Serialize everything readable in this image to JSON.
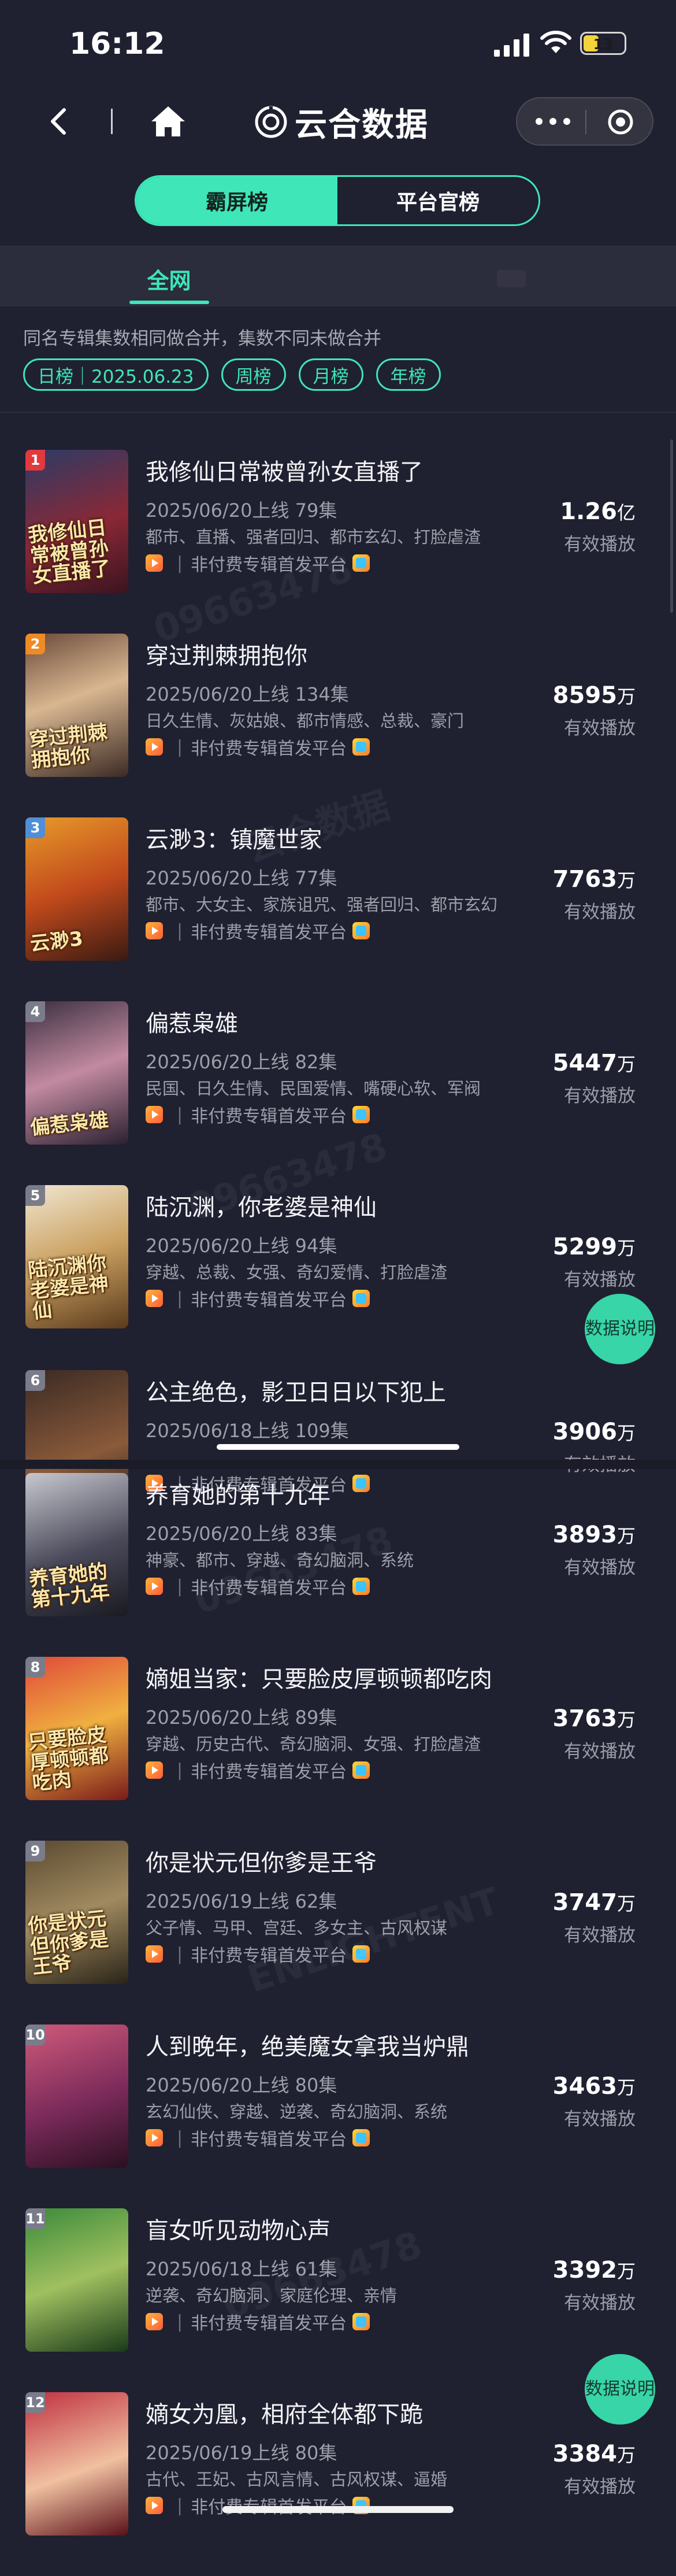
{
  "status_bar": {
    "time": "16:12",
    "battery": "13"
  },
  "nav": {
    "title": "云合数据"
  },
  "segment": {
    "tab_active": "霸屏榜",
    "tab_inactive": "平台官榜"
  },
  "subtab": {
    "label": "全网"
  },
  "note": "同名专辑集数相同做合并，集数不同未做合并",
  "chips": [
    "日榜｜2025.06.23",
    "周榜",
    "月榜",
    "年榜"
  ],
  "common": {
    "platform_label": "非付费专辑首发平台",
    "value_label": "有效播放",
    "float_button": "数据说明",
    "platform_separator": "|"
  },
  "watermarks": [
    "09663478",
    "云合数据",
    "ENLIGHTENT"
  ],
  "items": [
    {
      "rank": "1",
      "title": "我修仙日常被曾孙女直播了",
      "meta": "2025/06/20上线 79集",
      "tags": "都市、直播、强者回归、都市玄幻、打脸虐渣",
      "value_num": "1.26",
      "value_unit": "亿",
      "cover_text": "我修仙日常被曾孙女直播了",
      "rank_color": "#e0393e"
    },
    {
      "rank": "2",
      "title": "穿过荆棘拥抱你",
      "meta": "2025/06/20上线 134集",
      "tags": "日久生情、灰姑娘、都市情感、总裁、豪门",
      "value_num": "8595",
      "value_unit": "万",
      "cover_text": "穿过荆棘拥抱你",
      "rank_color": "#ef8a25"
    },
    {
      "rank": "3",
      "title": "云渺3：镇魔世家",
      "meta": "2025/06/20上线 77集",
      "tags": "都市、大女主、家族诅咒、强者回归、都市玄幻",
      "value_num": "7763",
      "value_unit": "万",
      "cover_text": "云渺3",
      "rank_color": "#4f8fd8"
    },
    {
      "rank": "4",
      "title": "偏惹枭雄",
      "meta": "2025/06/20上线 82集",
      "tags": "民国、日久生情、民国爱情、嘴硬心软、军阀",
      "value_num": "5447",
      "value_unit": "万",
      "cover_text": "偏惹枭雄",
      "rank_color": "#7b7c8a"
    },
    {
      "rank": "5",
      "title": "陆沉渊，你老婆是神仙",
      "meta": "2025/06/20上线 94集",
      "tags": "穿越、总裁、女强、奇幻爱情、打脸虐渣",
      "value_num": "5299",
      "value_unit": "万",
      "cover_text": "陆沉渊你老婆是神仙",
      "rank_color": "#7b7c8a"
    },
    {
      "rank": "6",
      "title": "公主绝色，影卫日日以下犯上",
      "meta": "2025/06/18上线 109集",
      "tags": "",
      "value_num": "3906",
      "value_unit": "万",
      "cover_text": "",
      "rank_color": "#7b7c8a"
    },
    {
      "rank": "",
      "title": "养育她的第十九年",
      "meta": "2025/06/20上线 83集",
      "tags": "神豪、都市、穿越、奇幻脑洞、系统",
      "value_num": "3893",
      "value_unit": "万",
      "cover_text": "养育她的第十九年",
      "rank_color": "#7b7c8a"
    },
    {
      "rank": "8",
      "title": "嫡姐当家：只要脸皮厚顿顿都吃肉",
      "meta": "2025/06/20上线 89集",
      "tags": "穿越、历史古代、奇幻脑洞、女强、打脸虐渣",
      "value_num": "3763",
      "value_unit": "万",
      "cover_text": "只要脸皮厚顿顿都吃肉",
      "rank_color": "#7b7c8a"
    },
    {
      "rank": "9",
      "title": "你是状元但你爹是王爷",
      "meta": "2025/06/19上线 62集",
      "tags": "父子情、马甲、宫廷、多女主、古风权谋",
      "value_num": "3747",
      "value_unit": "万",
      "cover_text": "你是状元但你爹是王爷",
      "rank_color": "#7b7c8a"
    },
    {
      "rank": "10",
      "title": "人到晚年，绝美魔女拿我当炉鼎",
      "meta": "2025/06/20上线 80集",
      "tags": "玄幻仙侠、穿越、逆袭、奇幻脑洞、系统",
      "value_num": "3463",
      "value_unit": "万",
      "cover_text": "",
      "rank_color": "#7b7c8a"
    },
    {
      "rank": "11",
      "title": "盲女听见动物心声",
      "meta": "2025/06/18上线 61集",
      "tags": "逆袭、奇幻脑洞、家庭伦理、亲情",
      "value_num": "3392",
      "value_unit": "万",
      "cover_text": "",
      "rank_color": "#7b7c8a"
    },
    {
      "rank": "12",
      "title": "嫡女为凰，相府全体都下跪",
      "meta": "2025/06/19上线 80集",
      "tags": "古代、王妃、古风言情、古风权谋、逼婚",
      "value_num": "3384",
      "value_unit": "万",
      "cover_text": "",
      "rank_color": "#7b7c8a"
    }
  ]
}
